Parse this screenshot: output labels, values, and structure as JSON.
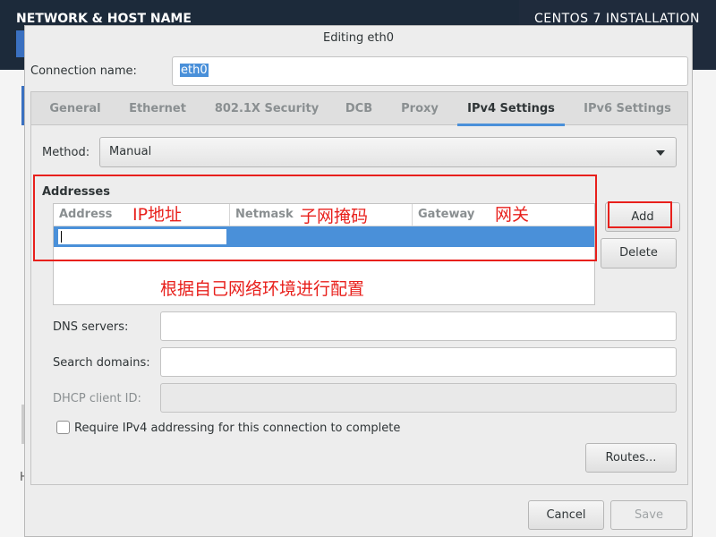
{
  "background": {
    "left_title": "NETWORK & HOST NAME",
    "right_title": "CENTOS 7 INSTALLATION",
    "fragment_left": "H",
    "fragment_right": "t"
  },
  "dialog": {
    "title": "Editing eth0",
    "connection_name_label": "Connection name:",
    "connection_name_value": "eth0"
  },
  "tabs": [
    {
      "label": "General",
      "active": false
    },
    {
      "label": "Ethernet",
      "active": false
    },
    {
      "label": "802.1X Security",
      "active": false
    },
    {
      "label": "DCB",
      "active": false
    },
    {
      "label": "Proxy",
      "active": false
    },
    {
      "label": "IPv4 Settings",
      "active": true
    },
    {
      "label": "IPv6 Settings",
      "active": false
    }
  ],
  "ipv4": {
    "method_label": "Method:",
    "method_value": "Manual",
    "addresses_heading": "Addresses",
    "columns": [
      "Address",
      "Netmask",
      "Gateway"
    ],
    "add_label": "Add",
    "delete_label": "Delete",
    "dns_label": "DNS servers:",
    "dns_value": "",
    "search_label": "Search domains:",
    "search_value": "",
    "dhcp_label": "DHCP client ID:",
    "dhcp_value": "",
    "require_label": "Require IPv4 addressing for this connection to complete",
    "require_checked": false,
    "routes_label": "Routes..."
  },
  "footer": {
    "cancel_label": "Cancel",
    "save_label": "Save"
  },
  "annotations": {
    "ip": "IP地址",
    "netmask": "子网掩码",
    "gateway": "网关",
    "note": "根据自己网络环境进行配置",
    "color": "#e8201c"
  },
  "colors": {
    "accent": "#4a90d9",
    "header": "#1c2a3a"
  }
}
